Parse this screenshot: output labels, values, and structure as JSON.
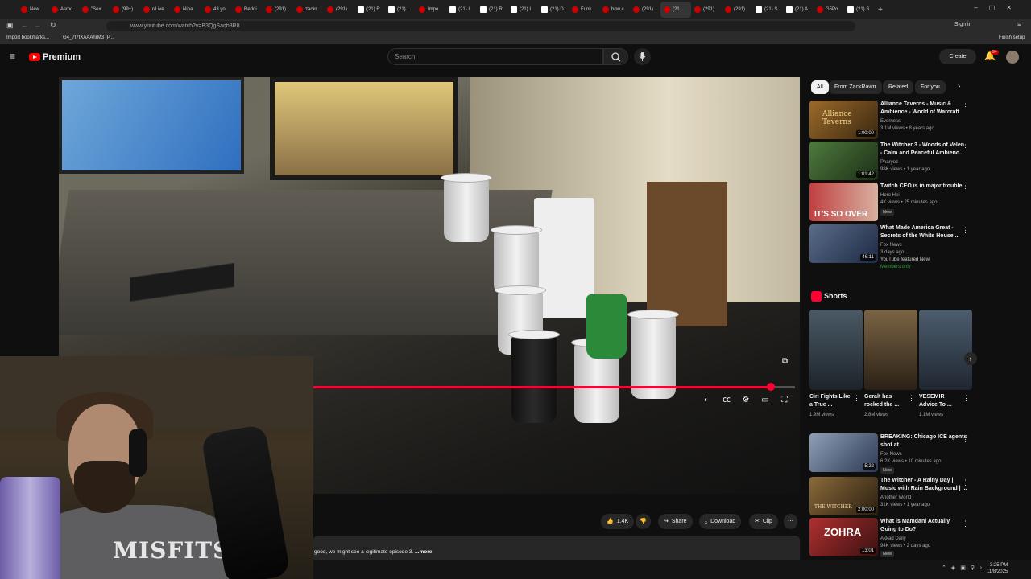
{
  "browser": {
    "tabs": [
      {
        "label": "New"
      },
      {
        "label": "Asmo"
      },
      {
        "label": "\"Sex"
      },
      {
        "label": "(99+)"
      },
      {
        "label": "r/Live"
      },
      {
        "label": "Nina"
      },
      {
        "label": "43 yo"
      },
      {
        "label": "Reddi"
      },
      {
        "label": "(291)"
      },
      {
        "label": "zackr"
      },
      {
        "label": "(291)"
      },
      {
        "label": "(21) R"
      },
      {
        "label": "(21) ..."
      },
      {
        "label": "Impo"
      },
      {
        "label": "(21) I"
      },
      {
        "label": "(21) R"
      },
      {
        "label": "(21) I"
      },
      {
        "label": "(21) D"
      },
      {
        "label": "Funk"
      },
      {
        "label": "how c"
      },
      {
        "label": "(291)"
      },
      {
        "label": "(21"
      },
      {
        "label": "(291)"
      },
      {
        "label": "(291)"
      },
      {
        "label": "(21) S"
      },
      {
        "label": "(21) A"
      },
      {
        "label": "G5Po"
      },
      {
        "label": "(21) S"
      }
    ],
    "url": "www.youtube.com/watch?v=B3QgSaqh3R8",
    "sign_in": "Sign in",
    "bookmarks": [
      "Import bookmarks...",
      "G4_7t7tXAAAhrM3 (P..."
    ],
    "finish_setup": "Finish setup"
  },
  "header": {
    "logo_text": "Premium",
    "search_placeholder": "Search",
    "create_label": "Create",
    "notif_count": "9+"
  },
  "video": {
    "progress_fraction": 0.95
  },
  "actions": {
    "likes": "1.4K",
    "share": "Share",
    "download": "Download",
    "clip": "Clip"
  },
  "description": {
    "snippet": "good, we might see a legitimate episode 3.",
    "more": "...more"
  },
  "webcam": {
    "shirt_text": "MISFITS"
  },
  "sidebar": {
    "chips": [
      "All",
      "From ZackRawrr",
      "Related",
      "For you"
    ],
    "recs": [
      {
        "title": "Alliance Taverns - Music & Ambience - World of Warcraft",
        "channel": "Everness",
        "meta": "3.1M views • 8 years ago",
        "duration": "1:00:00",
        "thumb_text": "Alliance Taverns",
        "color": "#6b4a1c"
      },
      {
        "title": "The Witcher 3 - Woods of Velen - Calm and Peaceful Ambienc...",
        "channel": "Pharyoz",
        "meta": "98K views • 1 year ago",
        "duration": "1:01:42",
        "color": "#2f5a2c"
      },
      {
        "title": "Twitch CEO is in major trouble",
        "channel": "Hero Hei",
        "meta": "4K views • 25 minutes ago",
        "badge": "New",
        "duration": "",
        "thumb_text": "IT'S SO OVER",
        "color": "#8a2b2b"
      },
      {
        "title": "What Made America Great - Secrets of the White House ...",
        "channel": "Fox News",
        "meta": "3 days ago",
        "badge": "YouTube featured   New",
        "members": "Members only",
        "duration": "46:11",
        "color": "#3c4a66"
      }
    ],
    "shorts_label": "Shorts",
    "shorts": [
      {
        "title": "Ciri Fights Like a True ...",
        "views": "1.9M views",
        "color": "#3b4a55"
      },
      {
        "title": "Geralt has rocked the ...",
        "views": "2.8M views",
        "color": "#5b4a35"
      },
      {
        "title": "VESEMIR Advice To ...",
        "views": "1.1M views",
        "color": "#3d4b58"
      }
    ],
    "recs2": [
      {
        "title": "BREAKING: Chicago ICE agents shot at",
        "channel": "Fox News",
        "meta": "6.2K views • 10 minutes ago",
        "badge": "New",
        "duration": "5:22",
        "color": "#3c5070"
      },
      {
        "title": "The Witcher - A Rainy Day | Music with Rain Background | ...",
        "channel": "Another World",
        "meta": "31K views • 1 year ago",
        "duration": "2:00:00",
        "thumb_text": "THE WITCHER",
        "color": "#5a4020"
      },
      {
        "title": "What is Mamdani Actually Going to Do?",
        "channel": "Akkad Daily",
        "meta": "94K views • 2 days ago",
        "badge": "New",
        "duration": "13:01",
        "thumb_text": "ZOHRA",
        "color": "#7a1e1e"
      }
    ]
  },
  "taskbar": {
    "time": "3:25 PM",
    "date": "11/8/2025"
  }
}
